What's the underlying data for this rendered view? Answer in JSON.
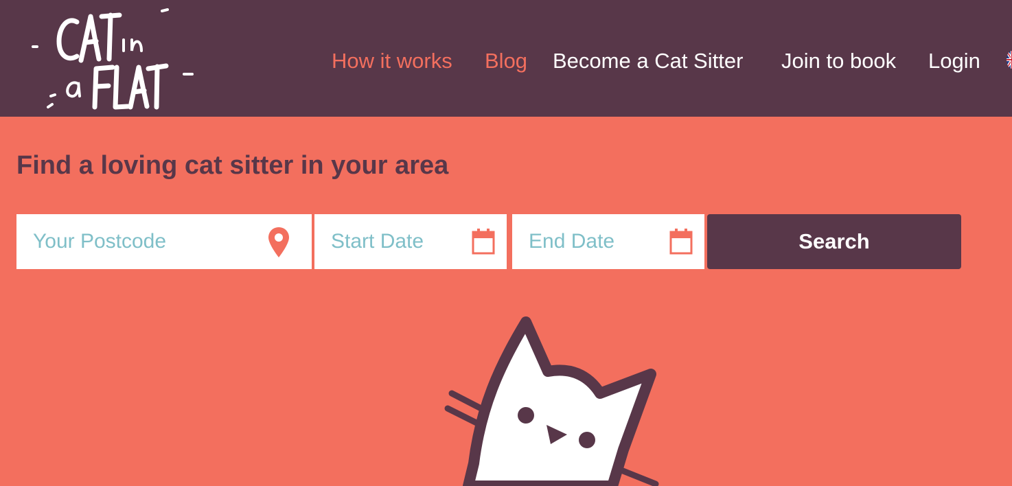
{
  "header": {
    "logo_alt": "Cat in a Flat",
    "nav": [
      {
        "label": "How it works"
      },
      {
        "label": "Blog"
      },
      {
        "label": "Become a Cat Sitter"
      },
      {
        "label": "Join to book"
      },
      {
        "label": "Login"
      }
    ],
    "language_icon": "uk-flag-icon"
  },
  "hero": {
    "title": "Find a loving cat sitter in your area"
  },
  "search": {
    "postcode_placeholder": "Your Postcode",
    "start_placeholder": "Start Date",
    "end_placeholder": "End Date",
    "button_label": "Search",
    "icons": {
      "postcode": "location-pin-icon",
      "start": "calendar-icon",
      "end": "calendar-icon"
    }
  },
  "colors": {
    "header_bg": "#583749",
    "page_bg": "#f36f5e",
    "accent": "#f36f5e",
    "placeholder": "#7fbfc8"
  }
}
